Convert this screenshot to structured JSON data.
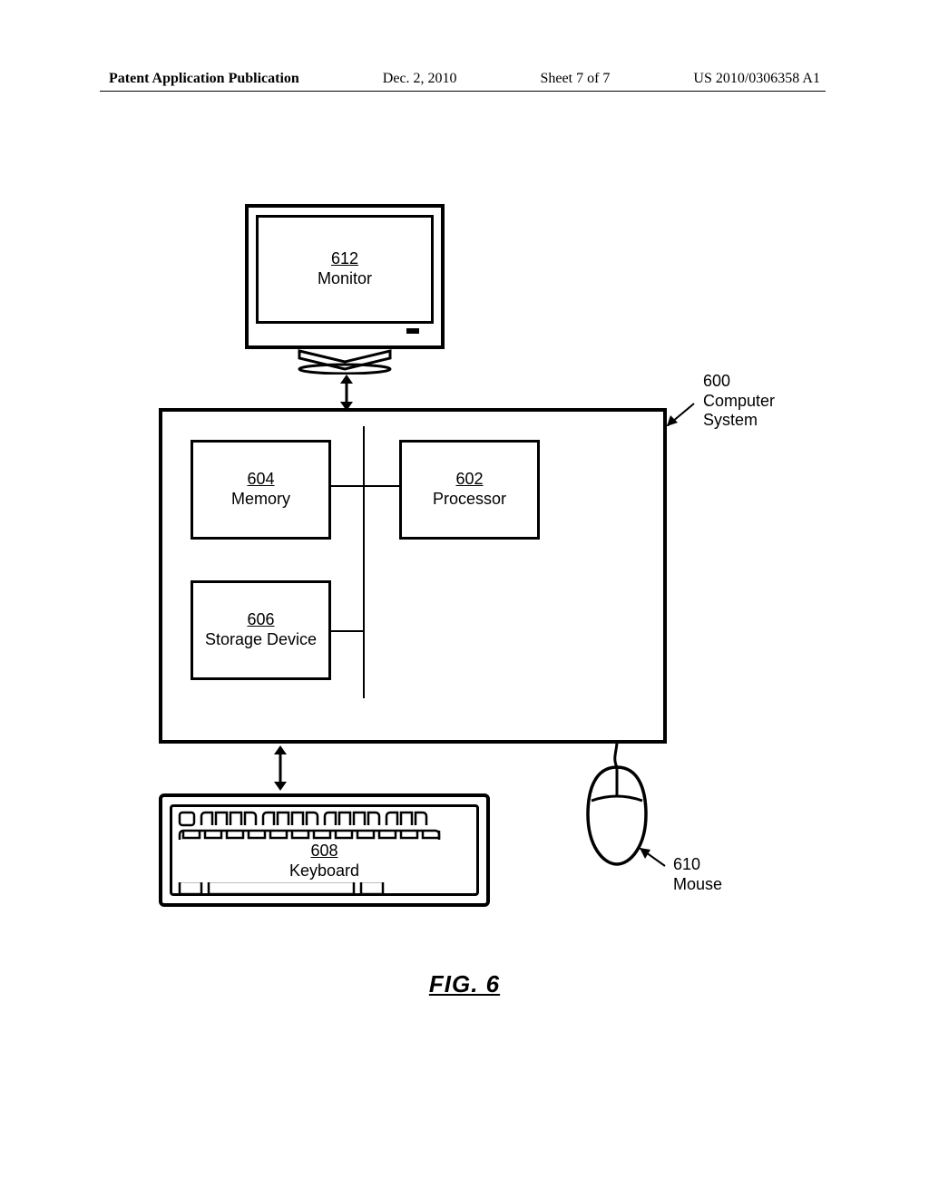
{
  "header": {
    "publication": "Patent Application Publication",
    "date": "Dec. 2, 2010",
    "sheet": "Sheet 7 of 7",
    "pubno": "US 2010/0306358 A1"
  },
  "monitor": {
    "ref": "612",
    "label": "Monitor"
  },
  "system": {
    "ref": "600",
    "label1": "Computer",
    "label2": "System"
  },
  "memory": {
    "ref": "604",
    "label": "Memory"
  },
  "processor": {
    "ref": "602",
    "label": "Processor"
  },
  "storage": {
    "ref": "606",
    "label": "Storage Device"
  },
  "keyboard": {
    "ref": "608",
    "label": "Keyboard"
  },
  "mouse": {
    "ref": "610",
    "label": "Mouse"
  },
  "caption": "FIG. 6"
}
